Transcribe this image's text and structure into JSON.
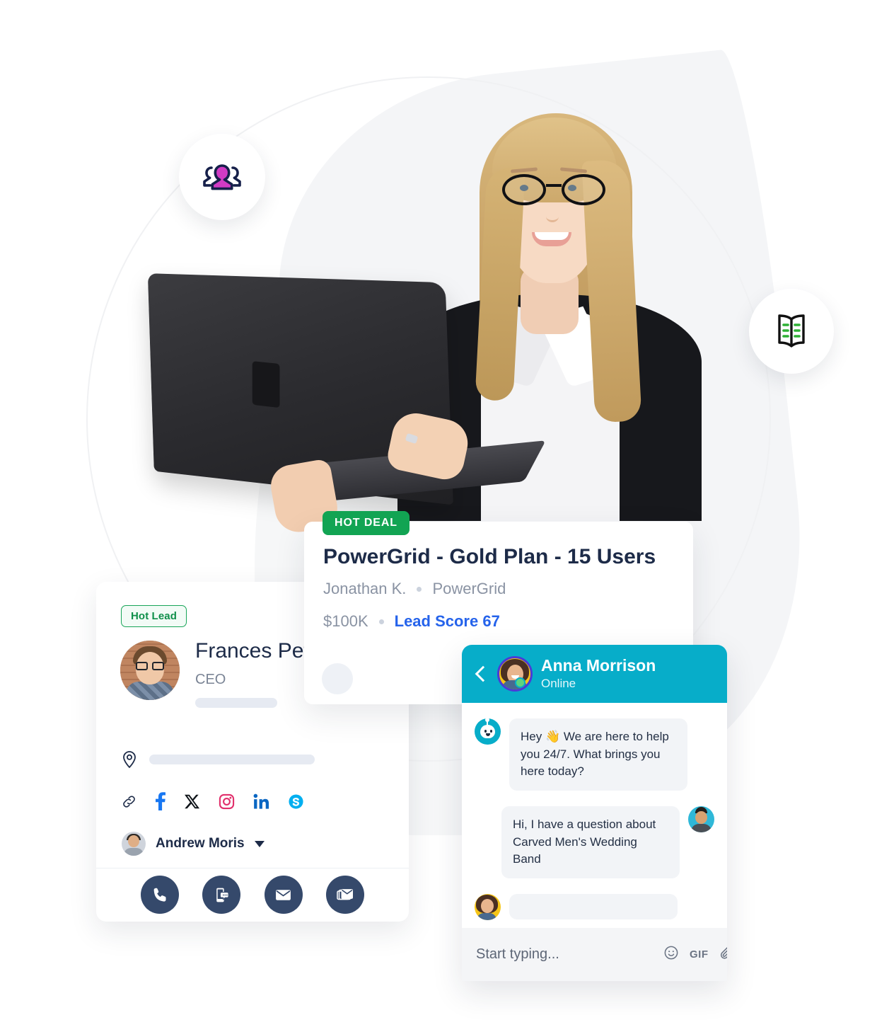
{
  "floating_badges": [
    {
      "name": "people-icon",
      "label": "Contacts"
    },
    {
      "name": "book-icon",
      "label": "Knowledge Base"
    }
  ],
  "contact_card": {
    "badge": "Hot Lead",
    "name": "Frances Pet",
    "role": "CEO",
    "owner_name": "Andrew Moris",
    "social_links": [
      "link-icon",
      "facebook-icon",
      "x-twitter-icon",
      "instagram-icon",
      "linkedin-icon",
      "skype-icon"
    ],
    "actions": [
      "call-button",
      "sms-button",
      "email-button",
      "bulk-email-button"
    ]
  },
  "deal_card": {
    "badge": "HOT DEAL",
    "title": "PowerGrid - Gold Plan - 15 Users",
    "contact": "Jonathan K.",
    "company": "PowerGrid",
    "amount": "$100K",
    "lead_score": "Lead Score 67"
  },
  "chat": {
    "agent_name": "Anna Morrison",
    "status": "Online",
    "messages": [
      {
        "from": "bot",
        "text": "Hey 👋 We are here to help you 24/7. What brings you here today?"
      },
      {
        "from": "user",
        "text": "Hi, I have a question about Carved Men's Wedding Band"
      },
      {
        "from": "agent",
        "text": ""
      }
    ],
    "input_placeholder": "Start typing...",
    "input_value": "",
    "footer_icons": [
      "emoji-icon",
      "GIF",
      "attachment-icon"
    ],
    "gif_label": "GIF"
  },
  "colors": {
    "hot_deal_green": "#12a453",
    "hot_lead_green": "#0f8f4a",
    "lead_score_blue": "#2563eb",
    "chat_teal": "#07adc9",
    "action_navy": "#35496b",
    "heading_navy": "#1d2b48"
  }
}
